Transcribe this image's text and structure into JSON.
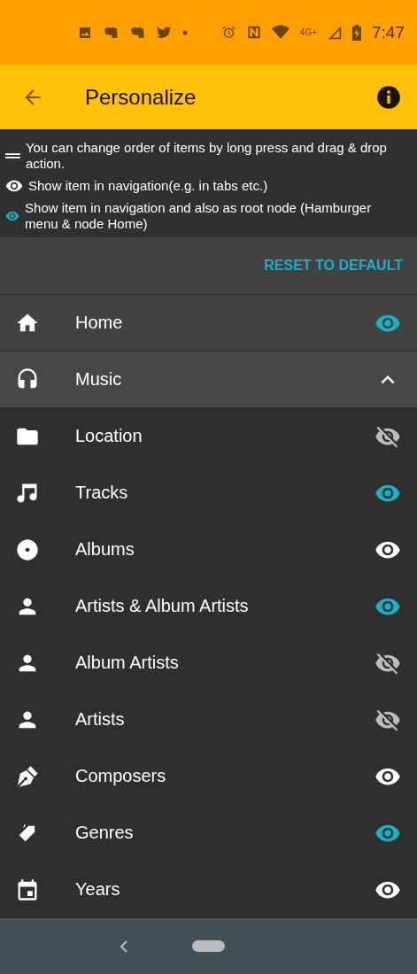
{
  "status_bar": {
    "network": "4G+",
    "time": "7:47"
  },
  "app_bar": {
    "title": "Personalize"
  },
  "legend": [
    {
      "kind": "drag",
      "text": "You can change order of items by long press and drag & drop action."
    },
    {
      "kind": "shown",
      "text": "Show item in navigation(e.g. in tabs etc.)"
    },
    {
      "kind": "root",
      "text": "Show item in navigation and also as root node (Hamburger menu & node Home)"
    }
  ],
  "reset_button": "RESET TO DEFAULT",
  "items": [
    {
      "kind": "home",
      "label": "Home",
      "visible": true,
      "root_node": true
    },
    {
      "kind": "headphones",
      "label": "Music",
      "expanded": true,
      "children": [
        {
          "kind": "folder",
          "label": "Location",
          "visible": false,
          "root_node": false
        },
        {
          "kind": "note",
          "label": "Tracks",
          "visible": true,
          "root_node": true
        },
        {
          "kind": "disc",
          "label": "Albums",
          "visible": true,
          "root_node": false
        },
        {
          "kind": "person",
          "label": "Artists & Album Artists",
          "visible": true,
          "root_node": true
        },
        {
          "kind": "person",
          "label": "Album Artists",
          "visible": false,
          "root_node": false
        },
        {
          "kind": "person",
          "label": "Artists",
          "visible": false,
          "root_node": false
        },
        {
          "kind": "pen",
          "label": "Composers",
          "visible": true,
          "root_node": false
        },
        {
          "kind": "tag",
          "label": "Genres",
          "visible": true,
          "root_node": true
        },
        {
          "kind": "calendar",
          "label": "Years",
          "visible": true,
          "root_node": false
        }
      ]
    }
  ]
}
